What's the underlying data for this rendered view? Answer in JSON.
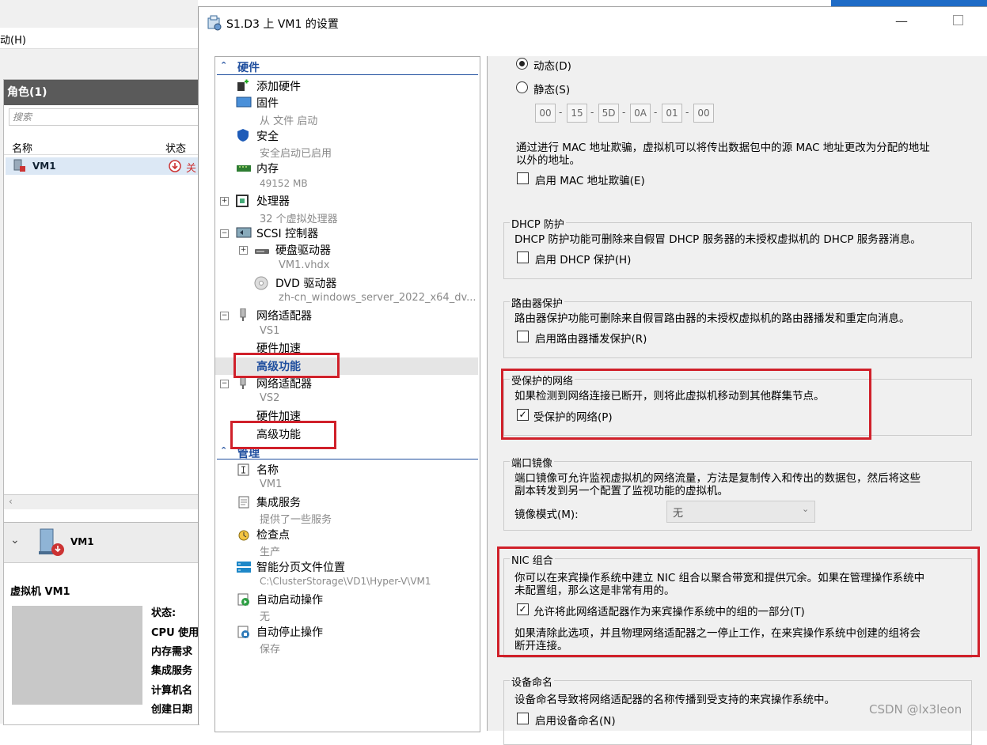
{
  "background": {
    "menu_item": "动(H)",
    "roles_title": "角色(1)",
    "search_placeholder": "搜索",
    "col_name": "名称",
    "col_status": "状态",
    "vm_name": "VM1",
    "vm_status": "关",
    "detail_vm": "VM1",
    "detail_label": "虚拟机 VM1",
    "detail_fields": [
      "状态:",
      "CPU 使用",
      "内存需求",
      "集成服务",
      "计算机名",
      "创建日期"
    ]
  },
  "dialog": {
    "title": "S1.D3 上 VM1 的设置"
  },
  "tree": {
    "hardware_header": "硬件",
    "management_header": "管理",
    "items": {
      "add_hw": "添加硬件",
      "firmware": "固件",
      "firmware_sub": "从 文件 启动",
      "security": "安全",
      "security_sub": "安全启动已启用",
      "memory": "内存",
      "memory_sub": "49152 MB",
      "processor": "处理器",
      "processor_sub": "32 个虚拟处理器",
      "scsi": "SCSI 控制器",
      "hdd": "硬盘驱动器",
      "hdd_sub": "VM1.vhdx",
      "dvd": "DVD 驱动器",
      "dvd_sub": "zh-cn_windows_server_2022_x64_dv...",
      "nic1": "网络适配器",
      "nic1_sub": "VS1",
      "nic1_hw": "硬件加速",
      "nic1_adv": "高级功能",
      "nic2": "网络适配器",
      "nic2_sub": "VS2",
      "nic2_hw": "硬件加速",
      "nic2_adv": "高级功能",
      "name": "名称",
      "name_sub": "VM1",
      "integration": "集成服务",
      "integration_sub": "提供了一些服务",
      "checkpoint": "检查点",
      "checkpoint_sub": "生产",
      "paging": "智能分页文件位置",
      "paging_sub": "C:\\ClusterStorage\\VD1\\Hyper-V\\VM1",
      "autostart": "自动启动操作",
      "autostart_sub": "无",
      "autostop": "自动停止操作",
      "autostop_sub": "保存"
    }
  },
  "right": {
    "mac": {
      "dynamic_label": "动态(D)",
      "static_label": "静态(S)",
      "octets": [
        "00",
        "15",
        "5D",
        "0A",
        "01",
        "00"
      ],
      "spoof_text_1": "通过进行 MAC 地址欺骗，虚拟机可以将传出数据包中的源 MAC 地址更改为分配的地址",
      "spoof_text_2": "以外的地址。",
      "spoof_checkbox": "启用 MAC 地址欺骗(E)"
    },
    "dhcp": {
      "title": "DHCP 防护",
      "text": "DHCP 防护功能可删除来自假冒 DHCP 服务器的未授权虚拟机的 DHCP 服务器消息。",
      "checkbox": "启用 DHCP 保护(H)"
    },
    "router": {
      "title": "路由器保护",
      "text": "路由器保护功能可删除来自假冒路由器的未授权虚拟机的路由器播发和重定向消息。",
      "checkbox": "启用路由器播发保护(R)"
    },
    "protected": {
      "title": "受保护的网络",
      "text": "如果检测到网络连接已断开，则将此虚拟机移动到其他群集节点。",
      "checkbox": "受保护的网络(P)"
    },
    "mirror": {
      "title": "端口镜像",
      "text_1": "端口镜像可允许监视虚拟机的网络流量，方法是复制传入和传出的数据包，然后将这些",
      "text_2": "副本转发到另一个配置了监视功能的虚拟机。",
      "mode_label": "镜像模式(M):",
      "mode_value": "无"
    },
    "nic_team": {
      "title": "NIC 组合",
      "text_1": "你可以在来宾操作系统中建立 NIC 组合以聚合带宽和提供冗余。如果在管理操作系统中",
      "text_2": "未配置组，那么这是非常有用的。",
      "checkbox": "允许将此网络适配器作为来宾操作系统中的组的一部分(T)",
      "note_1": "如果清除此选项，并且物理网络适配器之一停止工作，在来宾操作系统中创建的组将会",
      "note_2": "断开连接。"
    },
    "device_naming": {
      "title": "设备命名",
      "text": "设备命名导致将网络适配器的名称传播到受支持的来宾操作系统中。",
      "checkbox": "启用设备命名(N)"
    }
  },
  "watermark": "CSDN @lx3leon",
  "colors": {
    "highlight_red": "#d0202a",
    "section_blue": "#1f4e9e"
  }
}
